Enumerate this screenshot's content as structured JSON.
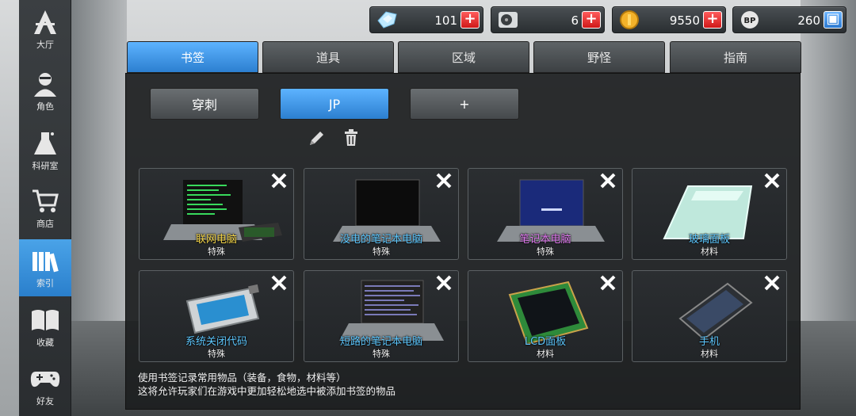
{
  "sidebar": {
    "items": [
      {
        "label": "大厅",
        "icon": "lobby-icon",
        "active": false
      },
      {
        "label": "角色",
        "icon": "character-icon",
        "active": false
      },
      {
        "label": "科研室",
        "icon": "lab-flask-icon",
        "active": false
      },
      {
        "label": "商店",
        "icon": "shop-cart-icon",
        "active": false
      },
      {
        "label": "索引",
        "icon": "index-books-icon",
        "active": true
      },
      {
        "label": "收藏",
        "icon": "open-book-icon",
        "active": false
      },
      {
        "label": "好友",
        "icon": "gamepad-icon",
        "active": false
      }
    ]
  },
  "currency": {
    "crystal": "101",
    "hdd": "6",
    "coin": "9550",
    "bp": "260"
  },
  "tabs": [
    "书签",
    "道具",
    "区域",
    "野怪",
    "指南"
  ],
  "bookmarks": {
    "buttons": [
      "穿刺",
      "JP",
      "+"
    ]
  },
  "items": [
    {
      "name": "联网电脑",
      "category": "特殊",
      "name_color": "#f5d64a"
    },
    {
      "name": "没电的笔记本电脑",
      "category": "特殊",
      "name_color": "#5ec8ff"
    },
    {
      "name": "笔记本电脑",
      "category": "特殊",
      "name_color": "#e07af0"
    },
    {
      "name": "玻璃面板",
      "category": "材料",
      "name_color": "#5ec8ff"
    },
    {
      "name": "系统关闭代码",
      "category": "特殊",
      "name_color": "#5ec8ff"
    },
    {
      "name": "短路的笔记本电脑",
      "category": "特殊",
      "name_color": "#5ec8ff"
    },
    {
      "name": "LCD面板",
      "category": "材料",
      "name_color": "#5ec8ff"
    },
    {
      "name": "手机",
      "category": "材料",
      "name_color": "#5ec8ff"
    }
  ],
  "hint": {
    "line1": "使用书签记录常用物品（装备，食物，材料等）",
    "line2": "这将允许玩家们在游戏中更加轻松地选中被添加书签的物品"
  },
  "colors": {
    "accent": "#2c7fd0",
    "plus_red": "#d01818"
  }
}
